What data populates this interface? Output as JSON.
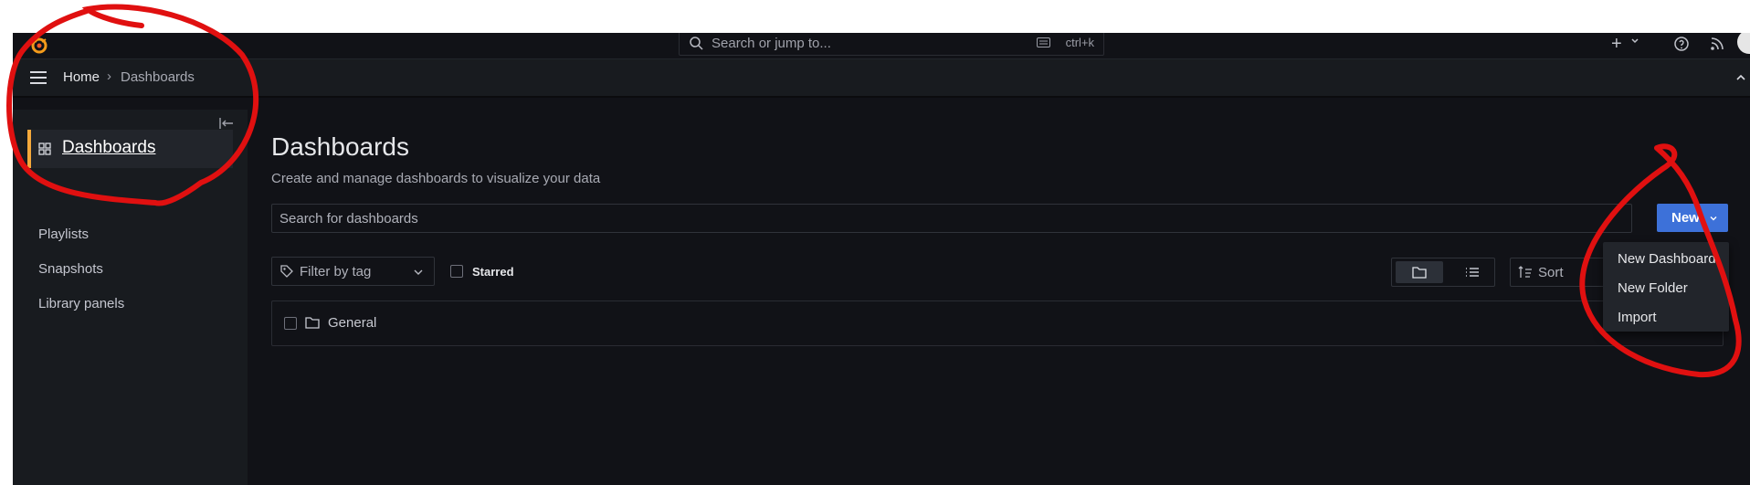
{
  "topbar": {
    "search_placeholder": "Search or jump to...",
    "shortcut": "ctrl+k",
    "add_label": "+"
  },
  "breadcrumb": {
    "home": "Home",
    "separator": "›",
    "current": "Dashboards"
  },
  "sidebar": {
    "active": {
      "label": "Dashboards",
      "accent": "#f5a93b"
    },
    "items": [
      {
        "label": "Playlists"
      },
      {
        "label": "Snapshots"
      },
      {
        "label": "Library panels"
      }
    ]
  },
  "main": {
    "title": "Dashboards",
    "subtitle": "Create and manage dashboards to visualize your data",
    "search_placeholder": "Search for dashboards",
    "new_button": "New",
    "filter_placeholder": "Filter by tag",
    "starred_label": "Starred",
    "sort_placeholder": "Sort",
    "folders": [
      {
        "name": "General"
      }
    ]
  },
  "new_menu": {
    "items": [
      "New Dashboard",
      "New Folder",
      "Import"
    ]
  },
  "colors": {
    "accent": "#3d71d9",
    "annotation": "#e01010",
    "background": "#111217"
  }
}
